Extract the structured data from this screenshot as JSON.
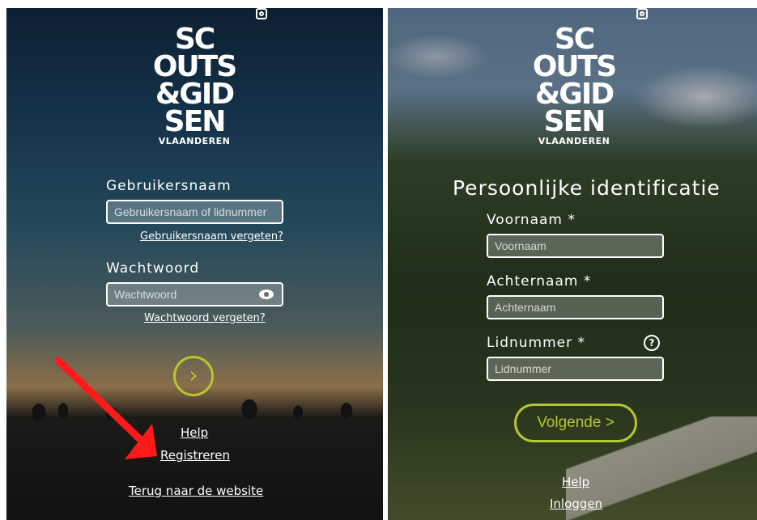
{
  "login": {
    "logo_lines": [
      "SC",
      "OUTS",
      "&GID",
      "SEN",
      "VLAANDEREN"
    ],
    "username_label": "Gebruikersnaam",
    "username_placeholder": "Gebruikersnaam of lidnummer",
    "forgot_username": "Gebruikersnaam vergeten?",
    "password_label": "Wachtwoord",
    "password_placeholder": "Wachtwoord",
    "forgot_password": "Wachtwoord vergeten?",
    "next_glyph": "›",
    "help": "Help",
    "register": "Registreren",
    "back": "Terug naar de website"
  },
  "register": {
    "logo_lines": [
      "SC",
      "OUTS",
      "&GID",
      "SEN",
      "VLAANDEREN"
    ],
    "heading": "Persoonlijke identificatie",
    "firstname_label": "Voornaam *",
    "firstname_placeholder": "Voornaam",
    "lastname_label": "Achternaam *",
    "lastname_placeholder": "Achternaam",
    "member_label": "Lidnummer *",
    "member_help_glyph": "?",
    "member_placeholder": "Lidnummer",
    "next_button": "Volgende >",
    "help": "Help",
    "login": "Inloggen"
  },
  "colors": {
    "accent": "#b5c630",
    "annotation_arrow": "#ff1a1a"
  }
}
